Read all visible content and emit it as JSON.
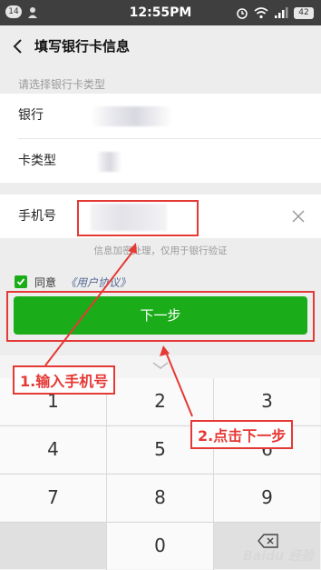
{
  "status_bar": {
    "notification_count": "14",
    "time": "12:55PM",
    "battery": "42",
    "icons": [
      "person-icon",
      "alarm-icon",
      "wifi-icon",
      "signal-icon",
      "battery-icon"
    ]
  },
  "nav": {
    "back_icon": "chevron-left-icon",
    "title": "填写银行卡信息"
  },
  "form": {
    "section_label": "请选择银行卡类型",
    "bank_label": "银行",
    "card_type_label": "卡类型",
    "phone_label": "手机号",
    "hint": "信息加密处理，仅用于银行验证"
  },
  "agreement": {
    "text": "同意",
    "link": "《用户协议》",
    "checked": true
  },
  "next_button": "下一步",
  "keyboard": {
    "keys": [
      "1",
      "2",
      "3",
      "4",
      "5",
      "6",
      "7",
      "8",
      "9",
      "0"
    ]
  },
  "annotations": {
    "step1": "1.输入手机号",
    "step2": "2.点击下一步",
    "color": "#e53935"
  },
  "watermark": "Baidu 经验",
  "colors": {
    "primary_green": "#1aad19",
    "link_blue": "#576b95",
    "status_bar": "#3f3f3f"
  }
}
